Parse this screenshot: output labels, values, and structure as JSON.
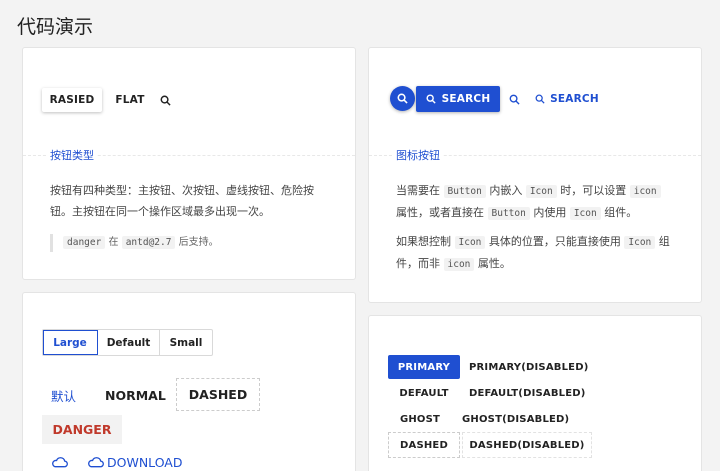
{
  "page": {
    "title": "代码演示"
  },
  "card1": {
    "buttons": {
      "raised": "RASIED",
      "flat": "FLAT"
    },
    "section_title": "按钮类型",
    "desc_line1": "按钮有四种类型：主按钮、次按钮、虚线按钮、危险按",
    "desc_line2": "钮。主按钮在同一个操作区域最多出现一次。",
    "note": {
      "code1": "danger",
      "t1": "在",
      "code2": "antd@2.7",
      "t2": "后支持。"
    }
  },
  "card2": {
    "buttons": {
      "search": "SEARCH",
      "search_link": "SEARCH"
    },
    "section_title": "图标按钮",
    "p1": {
      "t1": "当需要在",
      "c1": "Button",
      "t2": "内嵌入",
      "c2": "Icon",
      "t3": "时，可以设置",
      "c3": "icon",
      "t4": "属性，或者直接在",
      "c4": "Button",
      "t5": "内使用",
      "c5": "Icon",
      "t6": "组件。"
    },
    "p2": {
      "t1": "如果想控制",
      "c1": "Icon",
      "t2": "具体的位置，只能直接使用",
      "c2": "Icon",
      "t3": "组",
      "t4": "件，而非",
      "c3": "icon",
      "t5": "属性。"
    }
  },
  "card3": {
    "sizes": [
      "Large",
      "Default",
      "Small"
    ],
    "default_cn": "默认",
    "normal": "NORMAL",
    "dashed": "DASHED",
    "danger": "DANGER",
    "download": "DOWNLOAD"
  },
  "card4": {
    "primary": "PRIMARY",
    "primary_disabled": "PRIMARY(DISABLED)",
    "default": "DEFAULT",
    "default_disabled": "DEFAULT(DISABLED)",
    "ghost": "GHOST",
    "ghost_disabled": "GHOST(DISABLED)",
    "dashed": "DASHED",
    "dashed_disabled": "DASHED(DISABLED)"
  },
  "colors": {
    "accent": "#1f4fd1",
    "danger": "#c0392b",
    "danger_bg": "#f2f2f2"
  }
}
